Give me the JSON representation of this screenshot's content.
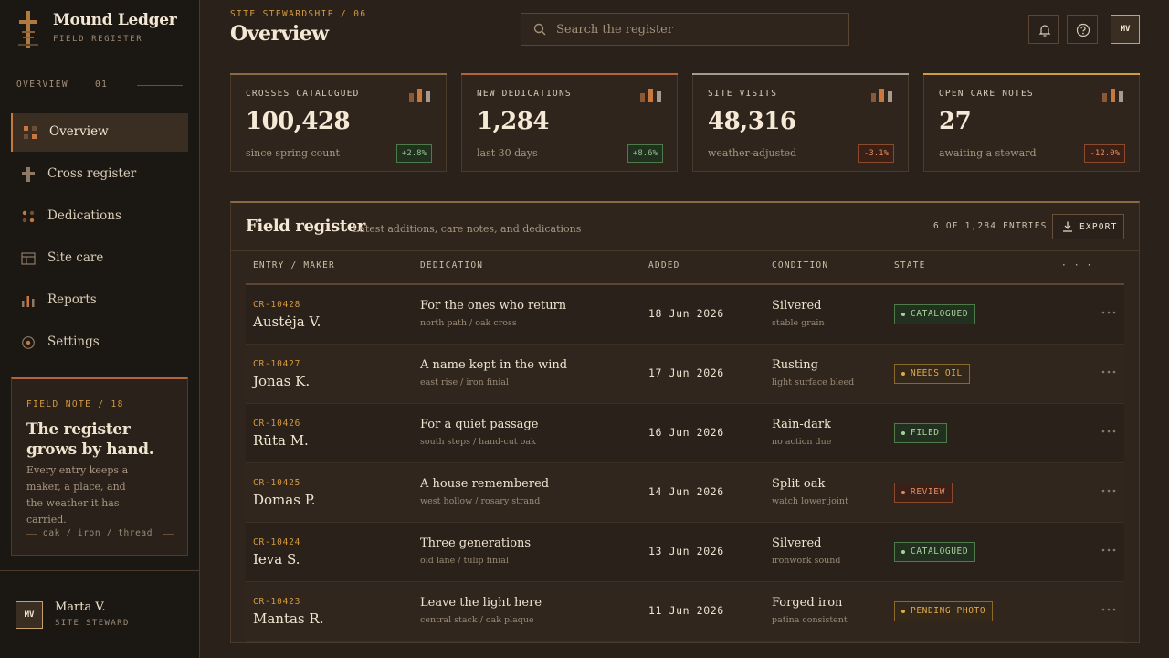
{
  "brand": {
    "title": "Mound Ledger",
    "subtitle": "FIELD REGISTER"
  },
  "nav": {
    "section_label": "OVERVIEW",
    "section_num": "01",
    "items": [
      {
        "label": "Overview",
        "icon": "grid-icon",
        "active": true
      },
      {
        "label": "Cross register",
        "icon": "cross-icon",
        "active": false
      },
      {
        "label": "Dedications",
        "icon": "dots-icon",
        "active": false
      },
      {
        "label": "Site care",
        "icon": "table-icon",
        "active": false
      },
      {
        "label": "Reports",
        "icon": "bar-chart-icon",
        "active": false
      },
      {
        "label": "Settings",
        "icon": "gear-icon",
        "active": false
      }
    ]
  },
  "note": {
    "kicker": "FIELD NOTE / 18",
    "title": "The register grows by hand.",
    "body": "Every entry keeps a maker, a place, and the weather it has carried.",
    "foot": "oak / iron / thread"
  },
  "user": {
    "initials": "MV",
    "name": "Marta V.",
    "role": "SITE STEWARD"
  },
  "header": {
    "breadcrumb": "SITE STEWARDSHIP / 06",
    "title": "Overview",
    "search_placeholder": "Search the register",
    "avatar_initials": "MV"
  },
  "stats": [
    {
      "label": "CROSSES CATALOGUED",
      "value": "100,428",
      "sub": "since spring count",
      "delta": "+2.8%",
      "trend": "up",
      "accent": "#8a6a44"
    },
    {
      "label": "NEW DEDICATIONS",
      "value": "1,284",
      "sub": "last 30 days",
      "delta": "+8.6%",
      "trend": "up",
      "accent": "#b4643a"
    },
    {
      "label": "SITE VISITS",
      "value": "48,316",
      "sub": "weather-adjusted",
      "delta": "-3.1%",
      "trend": "down",
      "accent": "#a59c90"
    },
    {
      "label": "OPEN CARE NOTES",
      "value": "27",
      "sub": "awaiting a steward",
      "delta": "-12.0%",
      "trend": "up",
      "accent": "#d49a3e"
    }
  ],
  "register": {
    "title": "Field register",
    "subtitle": "Latest additions, care notes, and dedications",
    "count": "6 OF 1,284 ENTRIES",
    "export_label": "EXPORT",
    "columns": [
      "ENTRY / MAKER",
      "DEDICATION",
      "ADDED",
      "CONDITION",
      "STATE",
      "· · ·"
    ],
    "rows": [
      {
        "id": "CR-10428",
        "maker": "Austėja V.",
        "dedication": "For the ones who return",
        "dedication_sub": "north path / oak cross",
        "added": "18 Jun 2026",
        "condition": "Silvered",
        "condition_sub": "stable grain",
        "state": "CATALOGUED",
        "tone": "green"
      },
      {
        "id": "CR-10427",
        "maker": "Jonas K.",
        "dedication": "A name kept in the wind",
        "dedication_sub": "east rise / iron finial",
        "added": "17 Jun 2026",
        "condition": "Rusting",
        "condition_sub": "light surface bleed",
        "state": "NEEDS OIL",
        "tone": "amber"
      },
      {
        "id": "CR-10426",
        "maker": "Rūta M.",
        "dedication": "For a quiet passage",
        "dedication_sub": "south steps / hand-cut oak",
        "added": "16 Jun 2026",
        "condition": "Rain-dark",
        "condition_sub": "no action due",
        "state": "FILED",
        "tone": "green"
      },
      {
        "id": "CR-10425",
        "maker": "Domas P.",
        "dedication": "A house remembered",
        "dedication_sub": "west hollow / rosary strand",
        "added": "14 Jun 2026",
        "condition": "Split oak",
        "condition_sub": "watch lower joint",
        "state": "REVIEW",
        "tone": "rust"
      },
      {
        "id": "CR-10424",
        "maker": "Ieva S.",
        "dedication": "Three generations",
        "dedication_sub": "old lane / tulip finial",
        "added": "13 Jun 2026",
        "condition": "Silvered",
        "condition_sub": "ironwork sound",
        "state": "CATALOGUED",
        "tone": "green"
      },
      {
        "id": "CR-10423",
        "maker": "Mantas R.",
        "dedication": "Leave the light here",
        "dedication_sub": "central stack / oak plaque",
        "added": "11 Jun 2026",
        "condition": "Forged iron",
        "condition_sub": "patina consistent",
        "state": "PENDING PHOTO",
        "tone": "amber"
      }
    ]
  }
}
